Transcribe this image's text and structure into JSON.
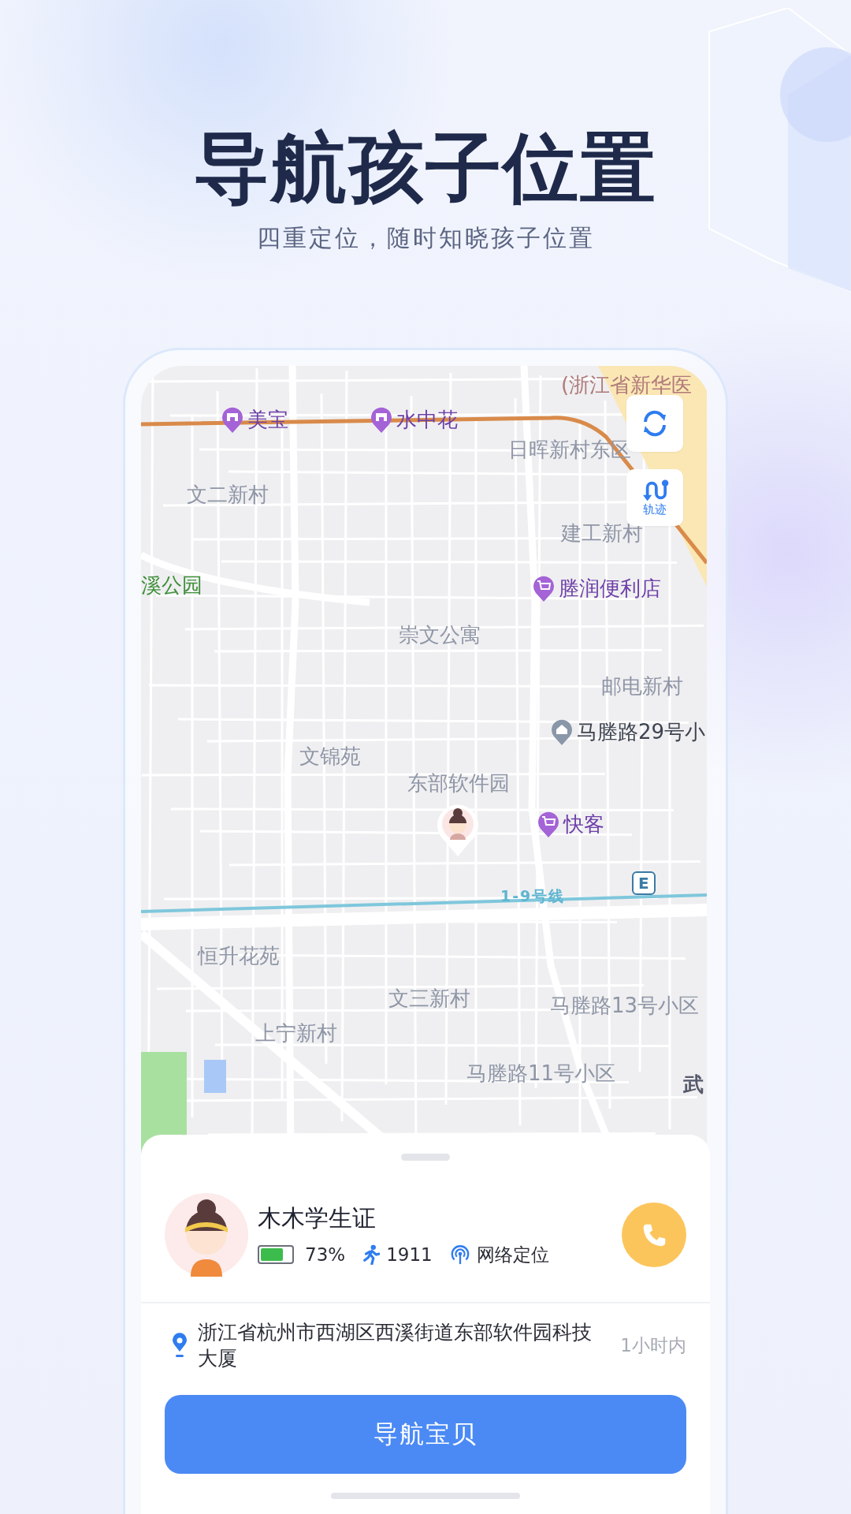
{
  "title": "导航孩子位置",
  "subtitle": "四重定位，随时知晓孩子位置",
  "map": {
    "labels": [
      {
        "kind": "hospital",
        "text": "(浙江省新华医"
      },
      {
        "kind": "store",
        "text": "美宝"
      },
      {
        "kind": "store",
        "text": "水中花"
      },
      {
        "kind": "area",
        "text": "日晖新村东区"
      },
      {
        "kind": "area",
        "text": "文二新村"
      },
      {
        "kind": "area",
        "text": "建工新村"
      },
      {
        "kind": "park",
        "text": "溪公园"
      },
      {
        "kind": "cart",
        "text": "塍润便利店"
      },
      {
        "kind": "area",
        "text": "崇文公寓"
      },
      {
        "kind": "area",
        "text": "邮电新村"
      },
      {
        "kind": "home",
        "text": "马塍路29号小"
      },
      {
        "kind": "area",
        "text": "文锦苑"
      },
      {
        "kind": "area",
        "text": "东部软件园"
      },
      {
        "kind": "cart",
        "text": "快客"
      },
      {
        "kind": "exit",
        "text": "E"
      },
      {
        "kind": "metro",
        "text": "1-9号线"
      },
      {
        "kind": "area",
        "text": "恒升花苑"
      },
      {
        "kind": "area",
        "text": "文三新村"
      },
      {
        "kind": "area",
        "text": "马塍路13号小区"
      },
      {
        "kind": "area",
        "text": "上宁新村"
      },
      {
        "kind": "area",
        "text": "马塍路11号小区"
      },
      {
        "kind": "road",
        "text": "武"
      }
    ],
    "buttons": [
      {
        "kind": "refresh"
      },
      {
        "kind": "track",
        "label": "轨迹"
      }
    ]
  },
  "device": {
    "name": "木木学生证",
    "battery": {
      "level": 0.73,
      "reading": "73%"
    },
    "steps": "1911",
    "location_mode": "网络定位"
  },
  "address": "浙江省杭州市西湖区西溪街道东部软件园科技大厦",
  "time": "1小时内",
  "navigate_button": "导航宝贝"
}
